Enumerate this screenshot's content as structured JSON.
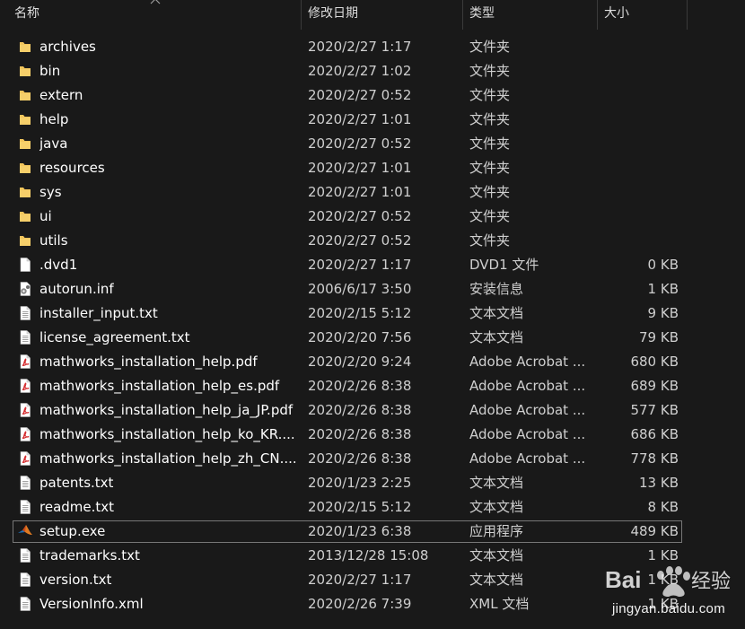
{
  "columns": {
    "name": "名称",
    "date": "修改日期",
    "type": "类型",
    "size": "大小"
  },
  "rows": [
    {
      "icon": "folder-icon",
      "name": "archives",
      "date": "2020/2/27 1:17",
      "type": "文件夹",
      "size": ""
    },
    {
      "icon": "folder-icon",
      "name": "bin",
      "date": "2020/2/27 1:02",
      "type": "文件夹",
      "size": ""
    },
    {
      "icon": "folder-icon",
      "name": "extern",
      "date": "2020/2/27 0:52",
      "type": "文件夹",
      "size": ""
    },
    {
      "icon": "folder-icon",
      "name": "help",
      "date": "2020/2/27 1:01",
      "type": "文件夹",
      "size": ""
    },
    {
      "icon": "folder-icon",
      "name": "java",
      "date": "2020/2/27 0:52",
      "type": "文件夹",
      "size": ""
    },
    {
      "icon": "folder-icon",
      "name": "resources",
      "date": "2020/2/27 1:01",
      "type": "文件夹",
      "size": ""
    },
    {
      "icon": "folder-icon",
      "name": "sys",
      "date": "2020/2/27 1:01",
      "type": "文件夹",
      "size": ""
    },
    {
      "icon": "folder-icon",
      "name": "ui",
      "date": "2020/2/27 0:52",
      "type": "文件夹",
      "size": ""
    },
    {
      "icon": "folder-icon",
      "name": "utils",
      "date": "2020/2/27 0:52",
      "type": "文件夹",
      "size": ""
    },
    {
      "icon": "file-icon",
      "name": ".dvd1",
      "date": "2020/2/27 1:17",
      "type": "DVD1 文件",
      "size": "0 KB"
    },
    {
      "icon": "settings-file-icon",
      "name": "autorun.inf",
      "date": "2006/6/17 3:50",
      "type": "安装信息",
      "size": "1 KB"
    },
    {
      "icon": "text-file-icon",
      "name": "installer_input.txt",
      "date": "2020/2/15 5:12",
      "type": "文本文档",
      "size": "9 KB"
    },
    {
      "icon": "text-file-icon",
      "name": "license_agreement.txt",
      "date": "2020/2/20 7:56",
      "type": "文本文档",
      "size": "79 KB"
    },
    {
      "icon": "pdf-icon",
      "name": "mathworks_installation_help.pdf",
      "date": "2020/2/20 9:24",
      "type": "Adobe Acrobat ...",
      "size": "680 KB"
    },
    {
      "icon": "pdf-icon",
      "name": "mathworks_installation_help_es.pdf",
      "date": "2020/2/26 8:38",
      "type": "Adobe Acrobat ...",
      "size": "689 KB"
    },
    {
      "icon": "pdf-icon",
      "name": "mathworks_installation_help_ja_JP.pdf",
      "date": "2020/2/26 8:38",
      "type": "Adobe Acrobat ...",
      "size": "577 KB"
    },
    {
      "icon": "pdf-icon",
      "name": "mathworks_installation_help_ko_KR....",
      "date": "2020/2/26 8:38",
      "type": "Adobe Acrobat ...",
      "size": "686 KB"
    },
    {
      "icon": "pdf-icon",
      "name": "mathworks_installation_help_zh_CN....",
      "date": "2020/2/26 8:38",
      "type": "Adobe Acrobat ...",
      "size": "778 KB"
    },
    {
      "icon": "text-file-icon",
      "name": "patents.txt",
      "date": "2020/1/23 2:25",
      "type": "文本文档",
      "size": "13 KB"
    },
    {
      "icon": "text-file-icon",
      "name": "readme.txt",
      "date": "2020/2/15 5:12",
      "type": "文本文档",
      "size": "8 KB"
    },
    {
      "icon": "matlab-icon",
      "name": "setup.exe",
      "date": "2020/1/23 6:38",
      "type": "应用程序",
      "size": "489 KB",
      "selected": true
    },
    {
      "icon": "text-file-icon",
      "name": "trademarks.txt",
      "date": "2013/12/28 15:08",
      "type": "文本文档",
      "size": "1 KB"
    },
    {
      "icon": "text-file-icon",
      "name": "version.txt",
      "date": "2020/2/27 1:17",
      "type": "文本文档",
      "size": "1 KB"
    },
    {
      "icon": "text-file-icon",
      "name": "VersionInfo.xml",
      "date": "2020/2/26 7:39",
      "type": "XML 文档",
      "size": "1 KB"
    }
  ],
  "watermark": {
    "logo_text": "Bai 经验",
    "url": "jingyan.baidu.com"
  },
  "colors": {
    "background": "#191919",
    "folder": "#f2c55c",
    "pdf": "#d4282b",
    "selection_border": "#777777"
  }
}
